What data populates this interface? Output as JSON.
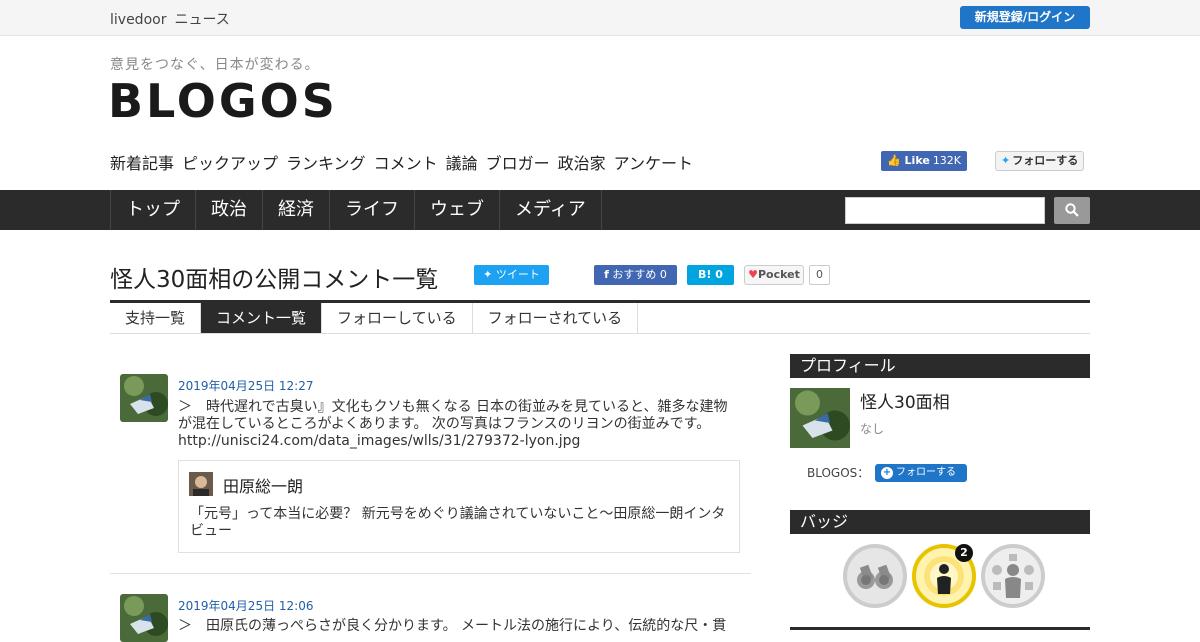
{
  "topbar": {
    "brand_a": "livedoor",
    "brand_b": "ニュース",
    "login_label": "新規登録/ログイン"
  },
  "header": {
    "tagline": "意見をつなぐ、日本が変わる。",
    "logo": "BLOGOS",
    "subnav": [
      "新着記事",
      "ピックアップ",
      "ランキング",
      "コメント",
      "議論",
      "ブロガー",
      "政治家",
      "アンケート"
    ],
    "fb_like": {
      "label": "Like",
      "count": "132K"
    },
    "tw_follow_label": "フォローする"
  },
  "mainnav": {
    "items": [
      "トップ",
      "政治",
      "経済",
      "ライフ",
      "ウェブ",
      "メディア"
    ],
    "search_placeholder": ""
  },
  "page": {
    "title": "怪人30面相の公開コメント一覧",
    "tweet_label": "ツイート",
    "fb_recommend": {
      "label": "おすすめ",
      "count": "0"
    },
    "hatena": {
      "label": "B!",
      "count": "0"
    },
    "pocket": {
      "label": "Pocket",
      "count": "0"
    }
  },
  "tabs": [
    {
      "label": "支持一覧",
      "active": false
    },
    {
      "label": "コメント一覧",
      "active": true
    },
    {
      "label": "フォローしている",
      "active": false
    },
    {
      "label": "フォローされている",
      "active": false
    }
  ],
  "comments": [
    {
      "date": "2019年04月25日 12:27",
      "text_line1": "＞　時代遅れで古臭い』文化もクソも無くなる 日本の街並みを見ていると、雑多な建物",
      "text_line2": "が混在しているところがよくあります。 次の写真はフランスのリヨンの街並みです。",
      "text_line3": "http://unisci24.com/data_images/wlls/31/279372-lyon.jpg",
      "quote": {
        "author": "田原総一朗",
        "title_line1": "「元号」って本当に必要？ 新元号をめぐり議論されていないこと〜田原総一朗インタ",
        "title_line2": "ビュー"
      }
    },
    {
      "date": "2019年04月25日 12:06",
      "text_line1": "＞　田原氏の薄っぺらさが良く分かります。 メートル法の施行により、伝統的な尺・貫"
    }
  ],
  "sidebar": {
    "profile_heading": "プロフィール",
    "profile_name": "怪人30面相",
    "profile_desc": "なし",
    "blogos_label": "BLOGOS：",
    "follow_label": "フォローする",
    "badges_heading": "バッジ",
    "badge_count": "2"
  },
  "colors": {
    "accent": "#1f75c7",
    "nav_bg": "#2b2b2b",
    "date": "#1f5fa8"
  }
}
